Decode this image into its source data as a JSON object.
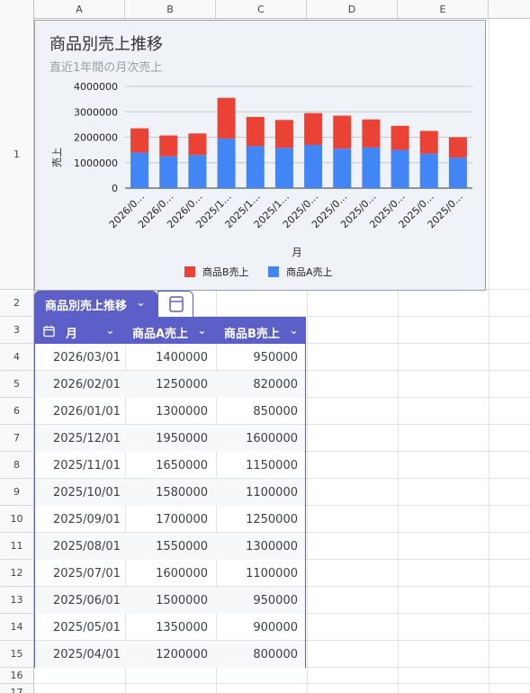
{
  "columns": [
    "A",
    "B",
    "C",
    "D",
    "E"
  ],
  "rows": [
    "1",
    "2",
    "3",
    "4",
    "5",
    "6",
    "7",
    "8",
    "9",
    "10",
    "11",
    "12",
    "13",
    "14",
    "15",
    "16",
    "17"
  ],
  "chart": {
    "title": "商品別売上推移",
    "subtitle": "直近1年間の月次売上",
    "colors": {
      "a": "#4285f4",
      "b": "#ea4335"
    }
  },
  "chart_data": {
    "type": "bar",
    "stacked": true,
    "title": "商品別売上推移",
    "subtitle": "直近1年間の月次売上",
    "xlabel": "月",
    "ylabel": "売上",
    "ylim": [
      0,
      4000000
    ],
    "yticks": [
      "4000000",
      "3000000",
      "2000000",
      "1000000",
      "0"
    ],
    "categories": [
      "2026/0…",
      "2026/0…",
      "2026/0…",
      "2025/1…",
      "2025/1…",
      "2025/1…",
      "2025/0…",
      "2025/0…",
      "2025/0…",
      "2025/0…",
      "2025/0…",
      "2025/0…"
    ],
    "series": [
      {
        "name": "商品A売上",
        "values": [
          1400000,
          1250000,
          1300000,
          1950000,
          1650000,
          1580000,
          1700000,
          1550000,
          1600000,
          1500000,
          1350000,
          1200000
        ]
      },
      {
        "name": "商品B売上",
        "values": [
          950000,
          820000,
          850000,
          1600000,
          1150000,
          1100000,
          1250000,
          1300000,
          1100000,
          950000,
          900000,
          800000
        ]
      }
    ],
    "legend": "bottom",
    "legend_items": [
      "商品B売上",
      "商品A売上"
    ],
    "grid": true
  },
  "table": {
    "name": "商品別売上推移",
    "headers": [
      "月",
      "商品A売上",
      "商品B売上"
    ],
    "rows": [
      [
        "2026/03/01",
        "1400000",
        "950000"
      ],
      [
        "2026/02/01",
        "1250000",
        "820000"
      ],
      [
        "2026/01/01",
        "1300000",
        "850000"
      ],
      [
        "2025/12/01",
        "1950000",
        "1600000"
      ],
      [
        "2025/11/01",
        "1650000",
        "1150000"
      ],
      [
        "2025/10/01",
        "1580000",
        "1100000"
      ],
      [
        "2025/09/01",
        "1700000",
        "1250000"
      ],
      [
        "2025/08/01",
        "1550000",
        "1300000"
      ],
      [
        "2025/07/01",
        "1600000",
        "1100000"
      ],
      [
        "2025/06/01",
        "1500000",
        "950000"
      ],
      [
        "2025/05/01",
        "1350000",
        "900000"
      ],
      [
        "2025/04/01",
        "1200000",
        "800000"
      ]
    ]
  }
}
